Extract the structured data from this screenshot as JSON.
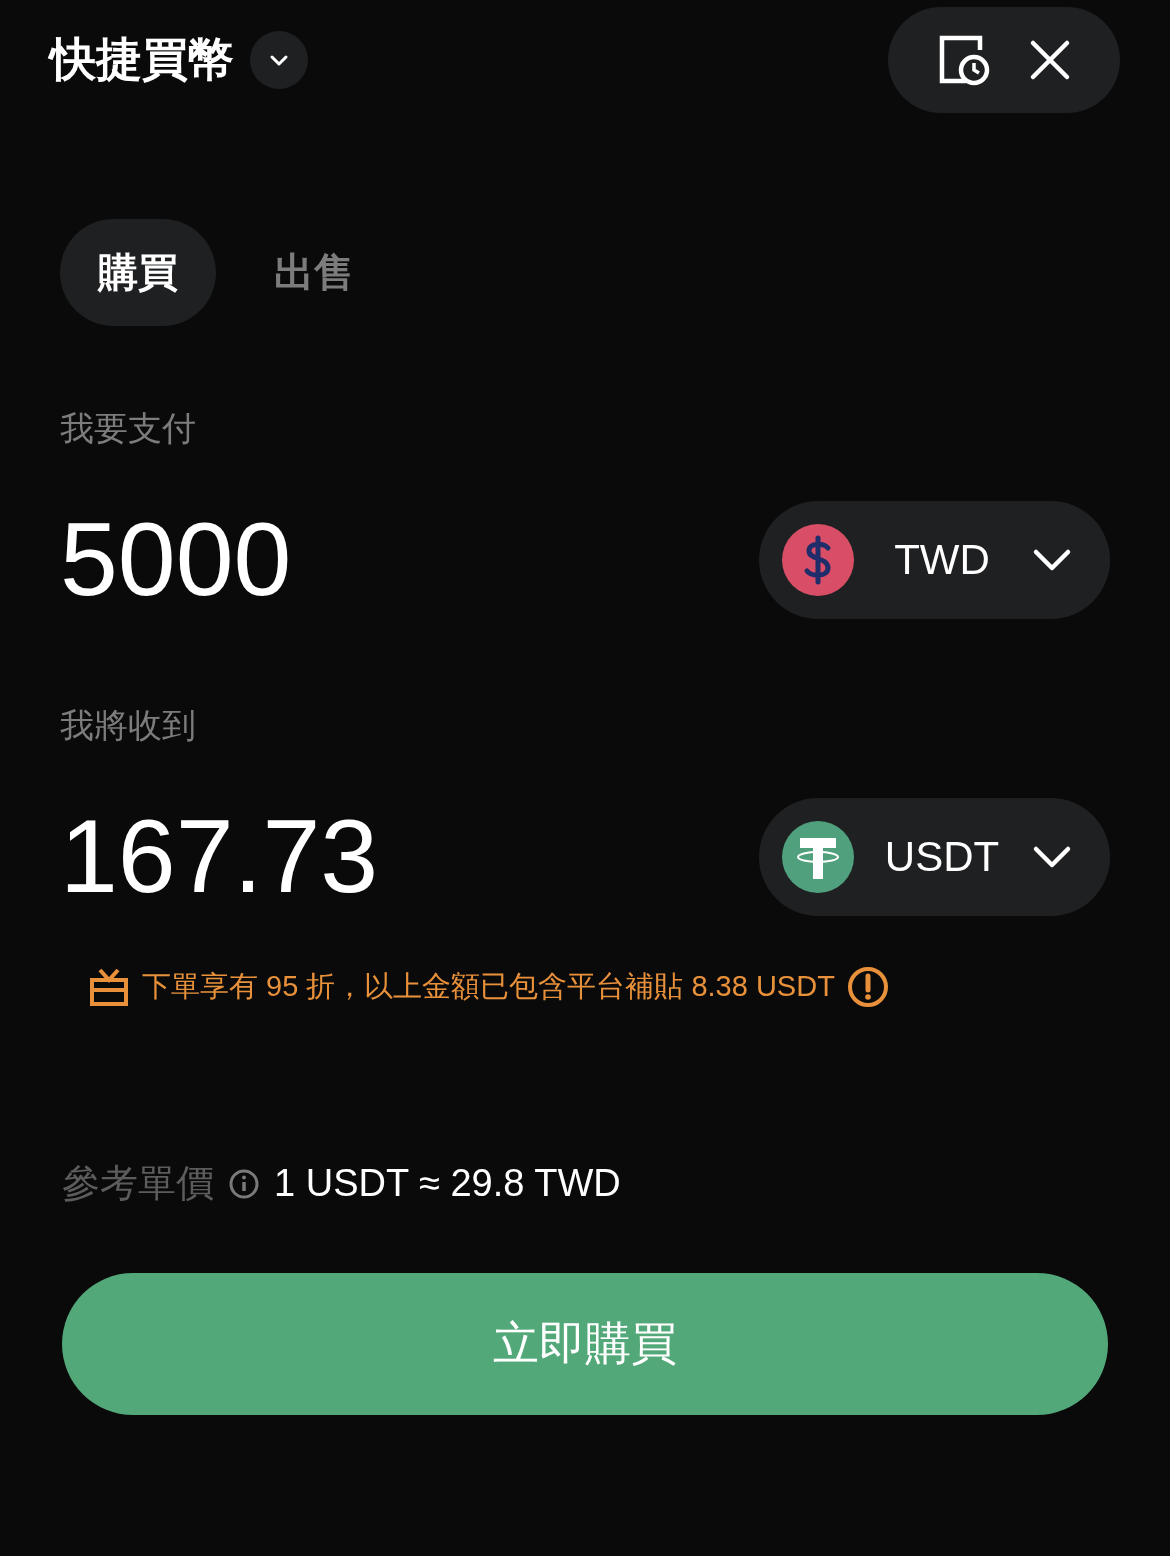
{
  "header": {
    "title": "快捷買幣"
  },
  "tabs": [
    {
      "label": "購買",
      "selected": true
    },
    {
      "label": "出售",
      "selected": false
    }
  ],
  "pay": {
    "label": "我要支付",
    "amount": "5000",
    "currency": {
      "code": "TWD",
      "kind": "dollar"
    }
  },
  "receive": {
    "label": "我將收到",
    "amount": "167.73",
    "currency": {
      "code": "USDT",
      "kind": "tether"
    }
  },
  "promo": {
    "text": "下單享有 95 折，以上金額已包含平台補貼 8.38 USDT"
  },
  "rate": {
    "label": "參考單價",
    "value": "1 USDT ≈ 29.8 TWD"
  },
  "action_button": {
    "label": "立即購買"
  }
}
